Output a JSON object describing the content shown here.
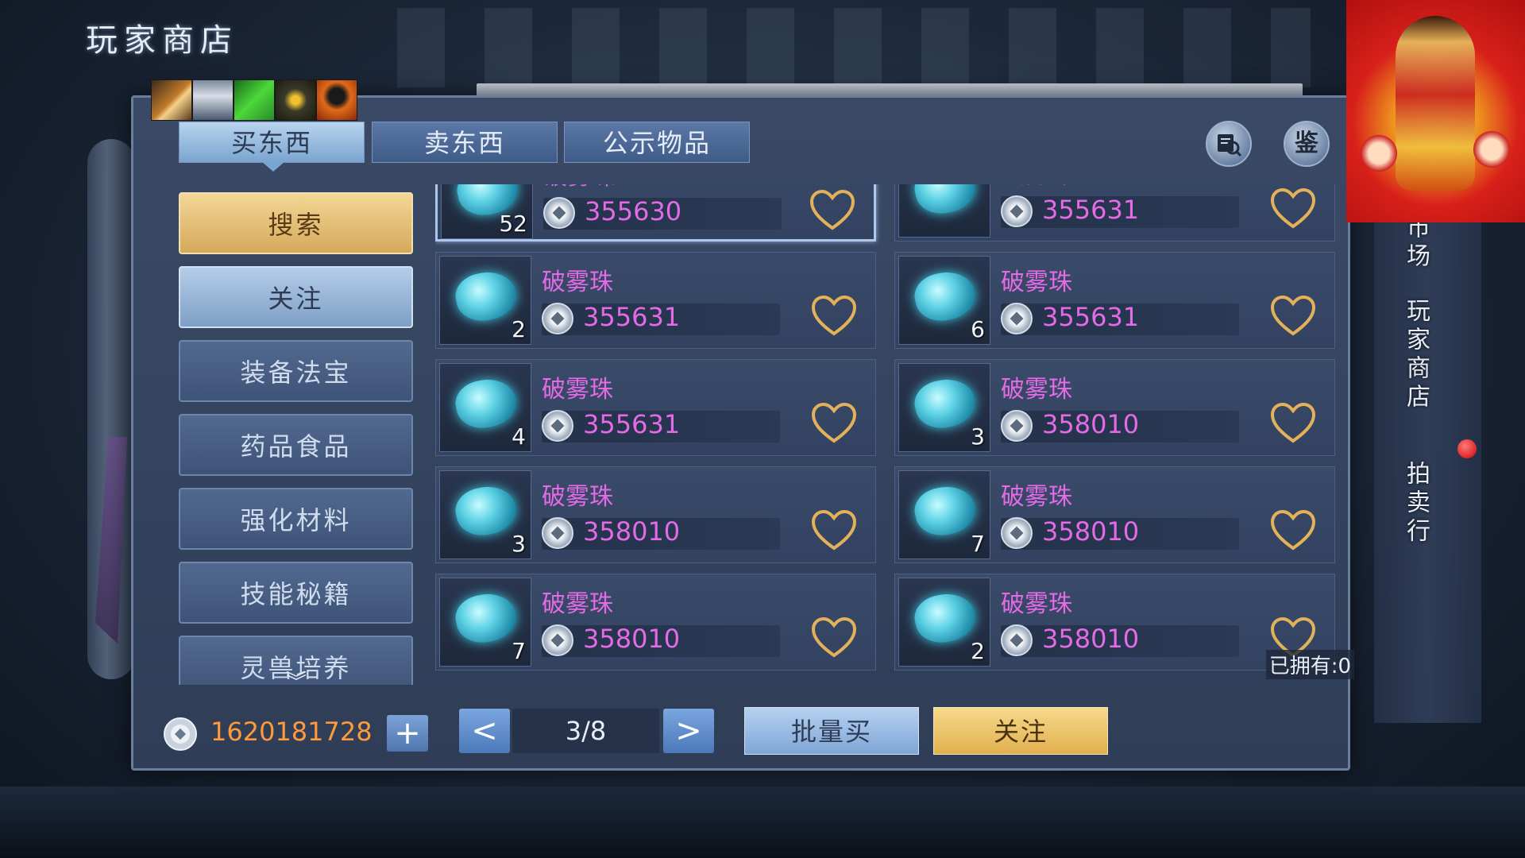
{
  "header": {
    "title": "玩家商店"
  },
  "top_icons": [
    "skill-icon-1",
    "skill-icon-2",
    "skill-icon-3",
    "skill-icon-4",
    "skill-icon-5"
  ],
  "tabs": [
    {
      "label": "买东西",
      "active": true
    },
    {
      "label": "卖东西",
      "active": false
    },
    {
      "label": "公示物品",
      "active": false
    }
  ],
  "round_buttons": {
    "search_icon": "magnifier-book-icon",
    "appraise_label": "鉴"
  },
  "categories": [
    {
      "label": "搜索",
      "state": "gold"
    },
    {
      "label": "关注",
      "state": "selected"
    },
    {
      "label": "装备法宝",
      "state": "normal"
    },
    {
      "label": "药品食品",
      "state": "normal"
    },
    {
      "label": "强化材料",
      "state": "normal"
    },
    {
      "label": "技能秘籍",
      "state": "normal"
    },
    {
      "label": "灵兽培养",
      "state": "normal"
    }
  ],
  "items": [
    {
      "name": "破雾珠",
      "qty": "52",
      "price": "355630",
      "selected": true
    },
    {
      "name": "破雾珠",
      "qty": "",
      "price": "355631",
      "selected": false
    },
    {
      "name": "破雾珠",
      "qty": "2",
      "price": "355631",
      "selected": false
    },
    {
      "name": "破雾珠",
      "qty": "6",
      "price": "355631",
      "selected": false
    },
    {
      "name": "破雾珠",
      "qty": "4",
      "price": "355631",
      "selected": false
    },
    {
      "name": "破雾珠",
      "qty": "3",
      "price": "358010",
      "selected": false
    },
    {
      "name": "破雾珠",
      "qty": "3",
      "price": "358010",
      "selected": false
    },
    {
      "name": "破雾珠",
      "qty": "7",
      "price": "358010",
      "selected": false
    },
    {
      "name": "破雾珠",
      "qty": "7",
      "price": "358010",
      "selected": false
    },
    {
      "name": "破雾珠",
      "qty": "2",
      "price": "358010",
      "selected": false
    }
  ],
  "owned_text": "已拥有:0",
  "footer": {
    "balance": "1620181728",
    "plus_label": "+",
    "page": "3/8",
    "prev_label": "<",
    "next_label": ">",
    "bulk_buy_label": "批量买",
    "follow_label": "关注"
  },
  "side_nav": [
    {
      "label": "市场"
    },
    {
      "label": "玩家商店"
    },
    {
      "label": "拍卖行"
    }
  ],
  "colors": {
    "price": "#e46ae6",
    "balance": "#ff9a3a",
    "accent_gold": "#e1b04e"
  }
}
